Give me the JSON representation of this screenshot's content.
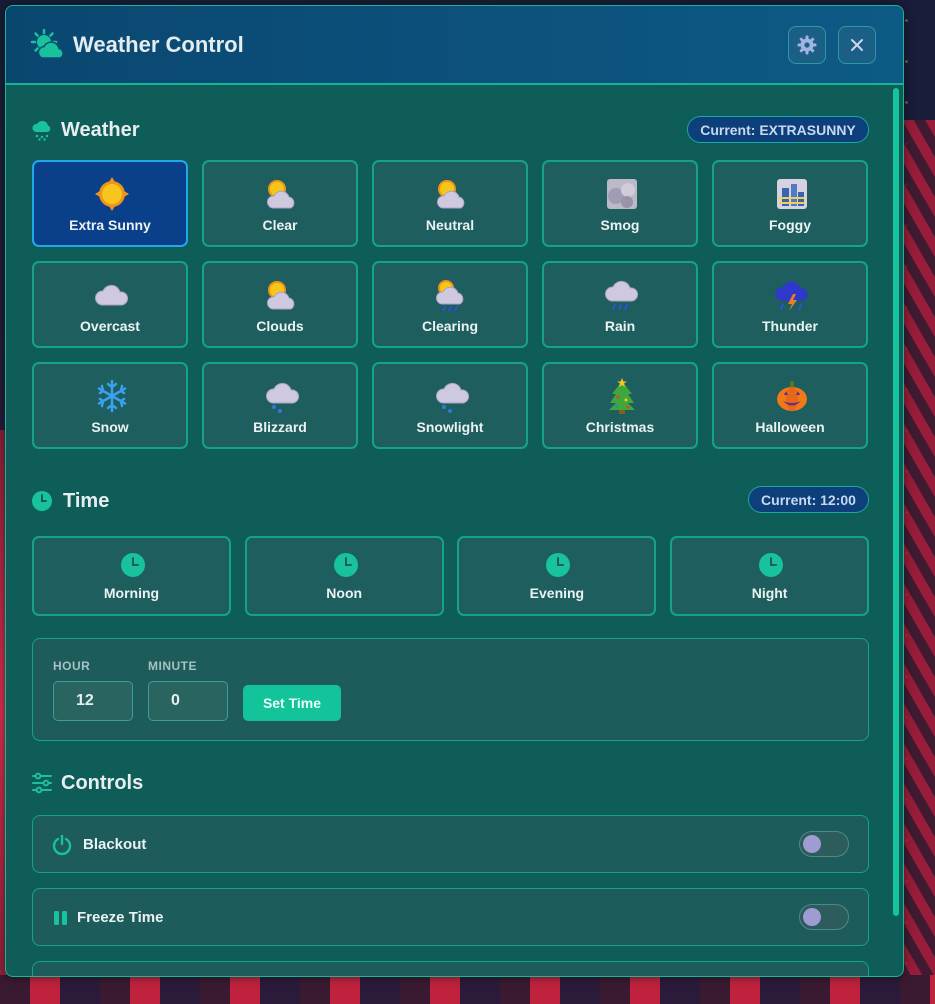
{
  "header": {
    "title": "Weather Control",
    "settings_icon": "gear-icon",
    "close_icon": "close-icon"
  },
  "weather": {
    "title": "Weather",
    "current": "Current: EXTRASUNNY",
    "items": [
      {
        "label": "Extra Sunny",
        "icon": "sun-icon",
        "active": true
      },
      {
        "label": "Clear",
        "icon": "sun-behind-cloud-icon"
      },
      {
        "label": "Neutral",
        "icon": "sun-behind-cloud-icon"
      },
      {
        "label": "Smog",
        "icon": "smog-icon"
      },
      {
        "label": "Foggy",
        "icon": "foggy-city-icon"
      },
      {
        "label": "Overcast",
        "icon": "cloud-icon"
      },
      {
        "label": "Clouds",
        "icon": "sun-behind-cloud-icon"
      },
      {
        "label": "Clearing",
        "icon": "sun-rain-cloud-icon"
      },
      {
        "label": "Rain",
        "icon": "rain-cloud-icon"
      },
      {
        "label": "Thunder",
        "icon": "thunder-cloud-icon"
      },
      {
        "label": "Snow",
        "icon": "snowflake-icon"
      },
      {
        "label": "Blizzard",
        "icon": "snow-cloud-icon"
      },
      {
        "label": "Snowlight",
        "icon": "snow-cloud-icon"
      },
      {
        "label": "Christmas",
        "icon": "christmas-tree-icon"
      },
      {
        "label": "Halloween",
        "icon": "pumpkin-icon"
      }
    ]
  },
  "time": {
    "title": "Time",
    "current": "Current: 12:00",
    "presets": [
      {
        "label": "Morning",
        "icon": "clock-icon"
      },
      {
        "label": "Noon",
        "icon": "clock-icon"
      },
      {
        "label": "Evening",
        "icon": "clock-icon"
      },
      {
        "label": "Night",
        "icon": "clock-icon"
      }
    ],
    "hour_label": "HOUR",
    "minute_label": "MINUTE",
    "hour_value": "12",
    "minute_value": "0",
    "set_label": "Set Time"
  },
  "controls": {
    "title": "Controls",
    "items": [
      {
        "label": "Blackout",
        "icon": "power-icon",
        "enabled": false
      },
      {
        "label": "Freeze Time",
        "icon": "pause-icon",
        "enabled": false
      }
    ]
  },
  "colors": {
    "accent": "#13c39a",
    "active_card": "#0a3f8a",
    "header": "#0a4770"
  }
}
